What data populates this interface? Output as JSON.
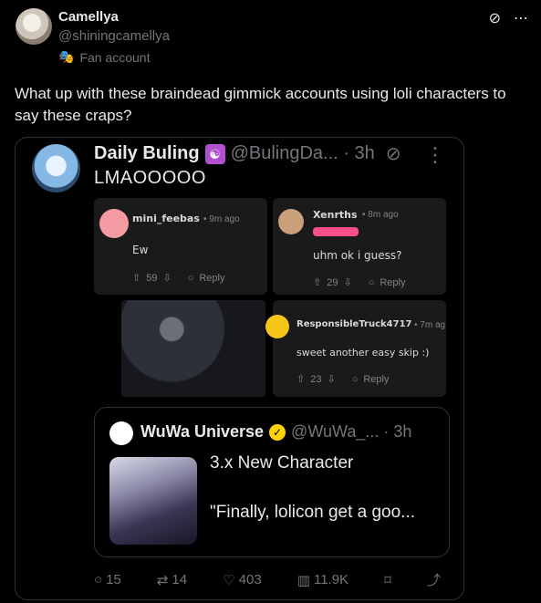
{
  "post": {
    "author_name": "Camellya",
    "author_handle": "@shiningcamellya",
    "fan_label": "Fan account",
    "text": "What up with these braindead gimmick accounts using loli characters to say these craps?"
  },
  "quoted": {
    "author_name": "Daily Buling",
    "handle_time": "@BulingDa... · 3h",
    "text": "LMAOOOOO",
    "reddit_comments": [
      {
        "user": "mini_feebas",
        "time": "• 9m ago",
        "body": "Ew",
        "votes": "59",
        "reply": "Reply"
      },
      {
        "user": "Xenrths",
        "time": "• 8m ago",
        "body": "uhm ok i guess?",
        "votes": "29",
        "reply": "Reply"
      },
      {
        "user": "ResponsibleTruck4717",
        "time": "• 7m ag",
        "body": "sweet another easy skip :)",
        "votes": "23",
        "reply": "Reply"
      }
    ],
    "inner_quote": {
      "author_name": "WuWa Universe",
      "handle_time": "@WuWa_... · 3h",
      "line1": "3.x New Character",
      "line2": "\"Finally, lolicon get a goo..."
    },
    "actions": {
      "replies": "15",
      "reposts": "14",
      "likes": "403",
      "views": "11.9K"
    }
  }
}
